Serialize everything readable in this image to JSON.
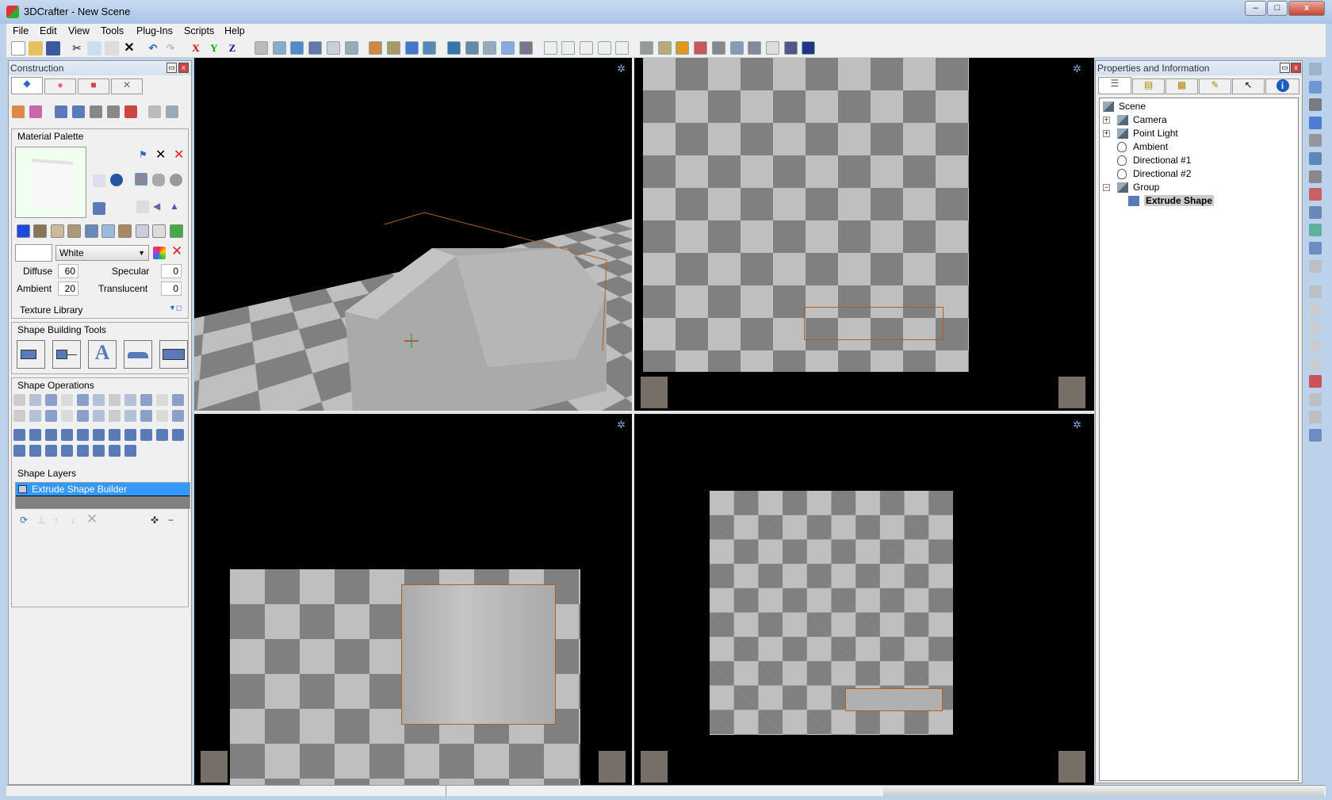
{
  "window": {
    "title": "3DCrafter - New Scene",
    "min": "–",
    "max": "□",
    "close": "x"
  },
  "menu": [
    "File",
    "Edit",
    "View",
    "Tools",
    "Plug-Ins",
    "Scripts",
    "Help"
  ],
  "toolbar": {
    "axis_x": "X",
    "axis_y": "Y",
    "axis_z": "Z",
    "icons": [
      "new-icon",
      "open-icon",
      "save-icon",
      "cut-icon",
      "copy-icon",
      "paste-icon",
      "delete-icon",
      "undo-icon",
      "redo-icon"
    ]
  },
  "construction": {
    "title": "Construction",
    "tabs": [
      "construct-tab",
      "color-tab",
      "objects-tab",
      "tools-tab"
    ],
    "material_palette": {
      "label": "Material Palette",
      "color_name": "White",
      "diffuse_label": "Diffuse",
      "diffuse": "60",
      "ambient_label": "Ambient",
      "ambient": "20",
      "specular_label": "Specular",
      "specular": "0",
      "translucent_label": "Translucent",
      "translucent": "0",
      "texture_library": "Texture Library"
    },
    "shape_building_tools": {
      "label": "Shape Building Tools",
      "text_tool": "A"
    },
    "shape_operations": {
      "label": "Shape Operations"
    },
    "shape_layers": {
      "label": "Shape Layers",
      "items": [
        "Extrude Shape Builder"
      ]
    }
  },
  "properties": {
    "title": "Properties and Information",
    "tree": [
      {
        "label": "Scene",
        "icon": "group-icon"
      },
      {
        "label": "Camera",
        "icon": "group-icon",
        "expand": "+"
      },
      {
        "label": "Point Light",
        "icon": "group-icon",
        "expand": "+"
      },
      {
        "label": "Ambient",
        "icon": "bulb-icon"
      },
      {
        "label": "Directional #1",
        "icon": "bulb-icon"
      },
      {
        "label": "Directional #2",
        "icon": "bulb-icon"
      },
      {
        "label": "Group",
        "icon": "group-icon",
        "expand": "−"
      },
      {
        "label": "Extrude Shape",
        "icon": "cube-icon",
        "selected": true
      }
    ]
  },
  "colors": {
    "selection": "#3399ff",
    "checker_light": "#bfbfbf",
    "checker_dark": "#808080",
    "viewport_bg": "#000000"
  }
}
